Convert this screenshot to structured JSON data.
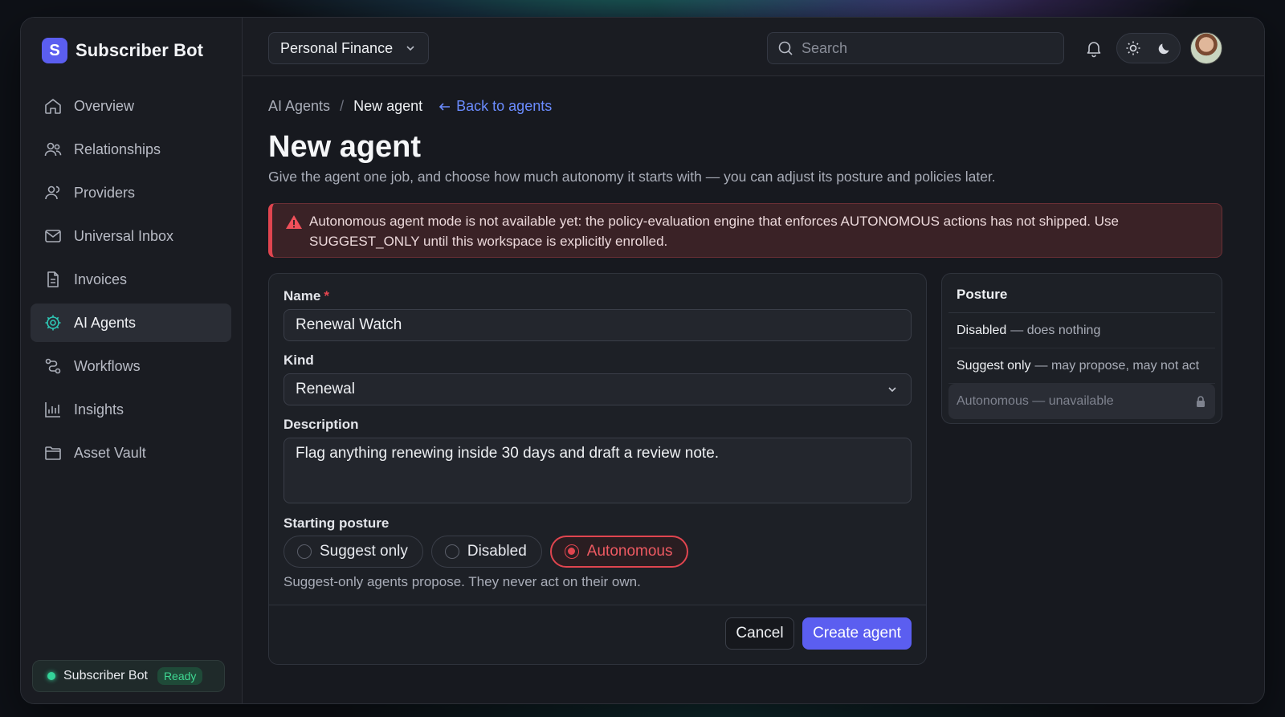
{
  "brand": {
    "logo_letter": "S",
    "name": "Subscriber Bot"
  },
  "sidebar": {
    "items": [
      {
        "label": "Overview",
        "icon": "home-icon"
      },
      {
        "label": "Relationships",
        "icon": "users-icon"
      },
      {
        "label": "Providers",
        "icon": "user-group-icon"
      },
      {
        "label": "Universal Inbox",
        "icon": "mail-icon"
      },
      {
        "label": "Invoices",
        "icon": "document-icon"
      },
      {
        "label": "AI Agents",
        "icon": "gear-icon",
        "active": true
      },
      {
        "label": "Workflows",
        "icon": "workflow-icon"
      },
      {
        "label": "Insights",
        "icon": "bar-chart-icon"
      },
      {
        "label": "Asset Vault",
        "icon": "folder-icon"
      }
    ],
    "status": {
      "name": "Subscriber Bot",
      "badge": "Ready"
    }
  },
  "topbar": {
    "workspace": "Personal Finance",
    "search_placeholder": "Search"
  },
  "breadcrumb": {
    "parent": "AI Agents",
    "separator": "/",
    "current": "New agent",
    "back": "Back to agents"
  },
  "page": {
    "title": "New agent",
    "subtitle": "Give the agent one job, and choose how much autonomy it starts with — you can adjust its posture and policies later."
  },
  "alert": {
    "text": "Autonomous agent mode is not available yet: the policy-evaluation engine that enforces AUTONOMOUS actions has not shipped. Use SUGGEST_ONLY until this workspace is explicitly enrolled."
  },
  "form": {
    "name_label": "Name",
    "required_mark": "*",
    "name_value": "Renewal Watch",
    "kind_label": "Kind",
    "kind_value": "Renewal",
    "description_label": "Description",
    "description_value": "Flag anything renewing inside 30 days and draft a review note.",
    "posture_label": "Starting posture",
    "posture_options": [
      "Suggest only",
      "Disabled",
      "Autonomous"
    ],
    "posture_selected": "Autonomous",
    "hint": "Suggest-only agents propose. They never act on their own.",
    "cancel": "Cancel",
    "submit": "Create agent"
  },
  "posture_panel": {
    "title": "Posture",
    "items": [
      {
        "name": "Disabled",
        "desc": "— does nothing"
      },
      {
        "name": "Suggest only",
        "desc": "— may propose, may not act"
      },
      {
        "name": "",
        "desc": "Autonomous — unavailable",
        "locked": true
      }
    ]
  },
  "colors": {
    "accent": "#5b5ef0",
    "active_icon": "#2ec8b6",
    "danger": "#e0454f",
    "success": "#34d399"
  }
}
